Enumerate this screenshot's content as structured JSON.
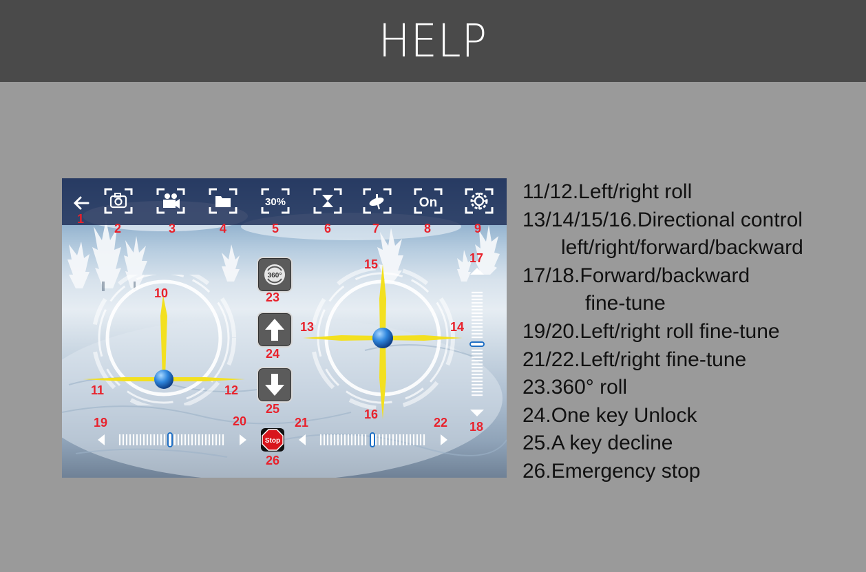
{
  "header": {
    "title": "HELP"
  },
  "screenshot": {
    "toolbar": [
      {
        "num": "1",
        "icon": "back-arrow-icon"
      },
      {
        "num": "2",
        "icon": "camera-icon"
      },
      {
        "num": "3",
        "icon": "video-camera-icon"
      },
      {
        "num": "4",
        "icon": "folder-icon"
      },
      {
        "num": "5",
        "icon": "speed-icon",
        "label": "30%"
      },
      {
        "num": "6",
        "icon": "hourglass-icon"
      },
      {
        "num": "7",
        "icon": "gyro-icon"
      },
      {
        "num": "8",
        "icon": "power-toggle-icon",
        "label": "On"
      },
      {
        "num": "9",
        "icon": "gear-icon"
      }
    ],
    "labels": {
      "n10": "10",
      "n11": "11",
      "n12": "12",
      "n13": "13",
      "n14": "14",
      "n15": "15",
      "n16": "16",
      "n17": "17",
      "n18": "18",
      "n19": "19",
      "n20": "20",
      "n21": "21",
      "n22": "22",
      "n23": "23",
      "n24": "24",
      "n25": "25",
      "n26": "26"
    },
    "rotate_label": "360°",
    "stop_label": "Stop"
  },
  "descriptions": [
    {
      "text": "11/12.Left/right roll",
      "indent": 0
    },
    {
      "text": "13/14/15/16.Directional control",
      "indent": 0
    },
    {
      "text": "left/right/forward/backward",
      "indent": 1
    },
    {
      "text": "17/18.Forward/backward",
      "indent": 0
    },
    {
      "text": "fine-tune",
      "indent": 2
    },
    {
      "text": "19/20.Left/right roll fine-tune",
      "indent": 0
    },
    {
      "text": "21/22.Left/right fine-tune",
      "indent": 0
    },
    {
      "text": "23.360° roll",
      "indent": 0
    },
    {
      "text": "24.One key Unlock",
      "indent": 0
    },
    {
      "text": "25.A key decline",
      "indent": 0
    },
    {
      "text": "26.Emergency stop",
      "indent": 0
    }
  ],
  "colors": {
    "header_bg": "#4a4a4a",
    "page_bg": "#9a9a9a",
    "label_red": "#e8222c",
    "axis_yellow": "#f3e020",
    "ball_blue": "#1f6fc4"
  }
}
